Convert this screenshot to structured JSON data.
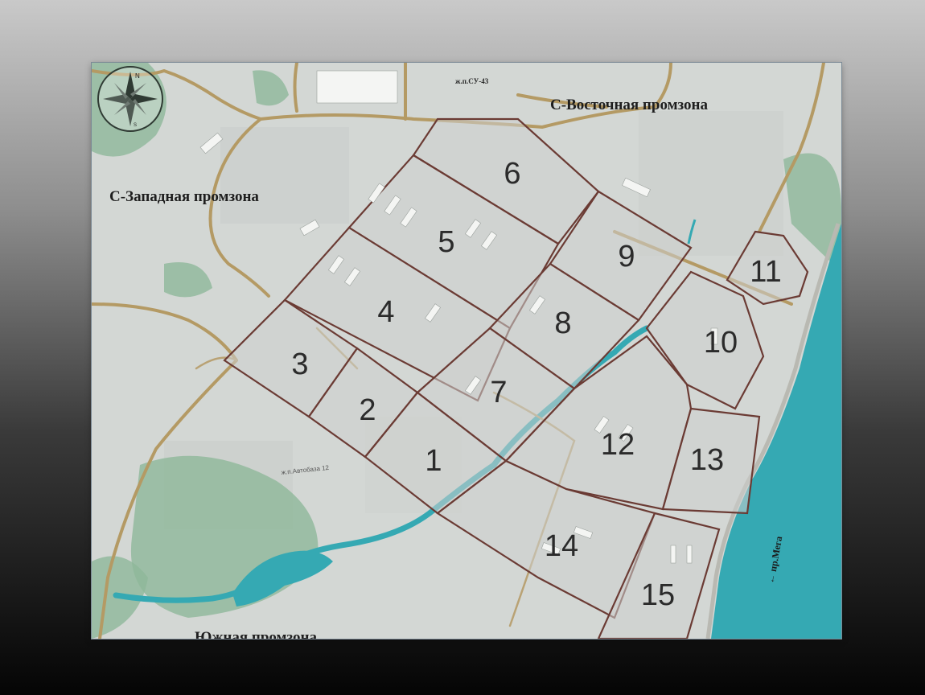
{
  "map": {
    "zones": {
      "northwest": "С-Западная промзона",
      "northeast": "С-Восточная промзона",
      "south": "Южная промзона"
    },
    "labels": {
      "top_road": "ж.п.СУ-43",
      "street": "ж.п.Автобаза 12",
      "river": "← пр.Мега"
    },
    "districts": [
      "1",
      "2",
      "3",
      "4",
      "5",
      "6",
      "7",
      "8",
      "9",
      "10",
      "11",
      "12",
      "13",
      "14",
      "15"
    ],
    "compass": {
      "north": "N",
      "south": "S"
    },
    "colors": {
      "water": "#35a9b3",
      "district_border": "#6b3b34",
      "road": "#b49a64",
      "vegetation": "#8fb89a"
    }
  }
}
